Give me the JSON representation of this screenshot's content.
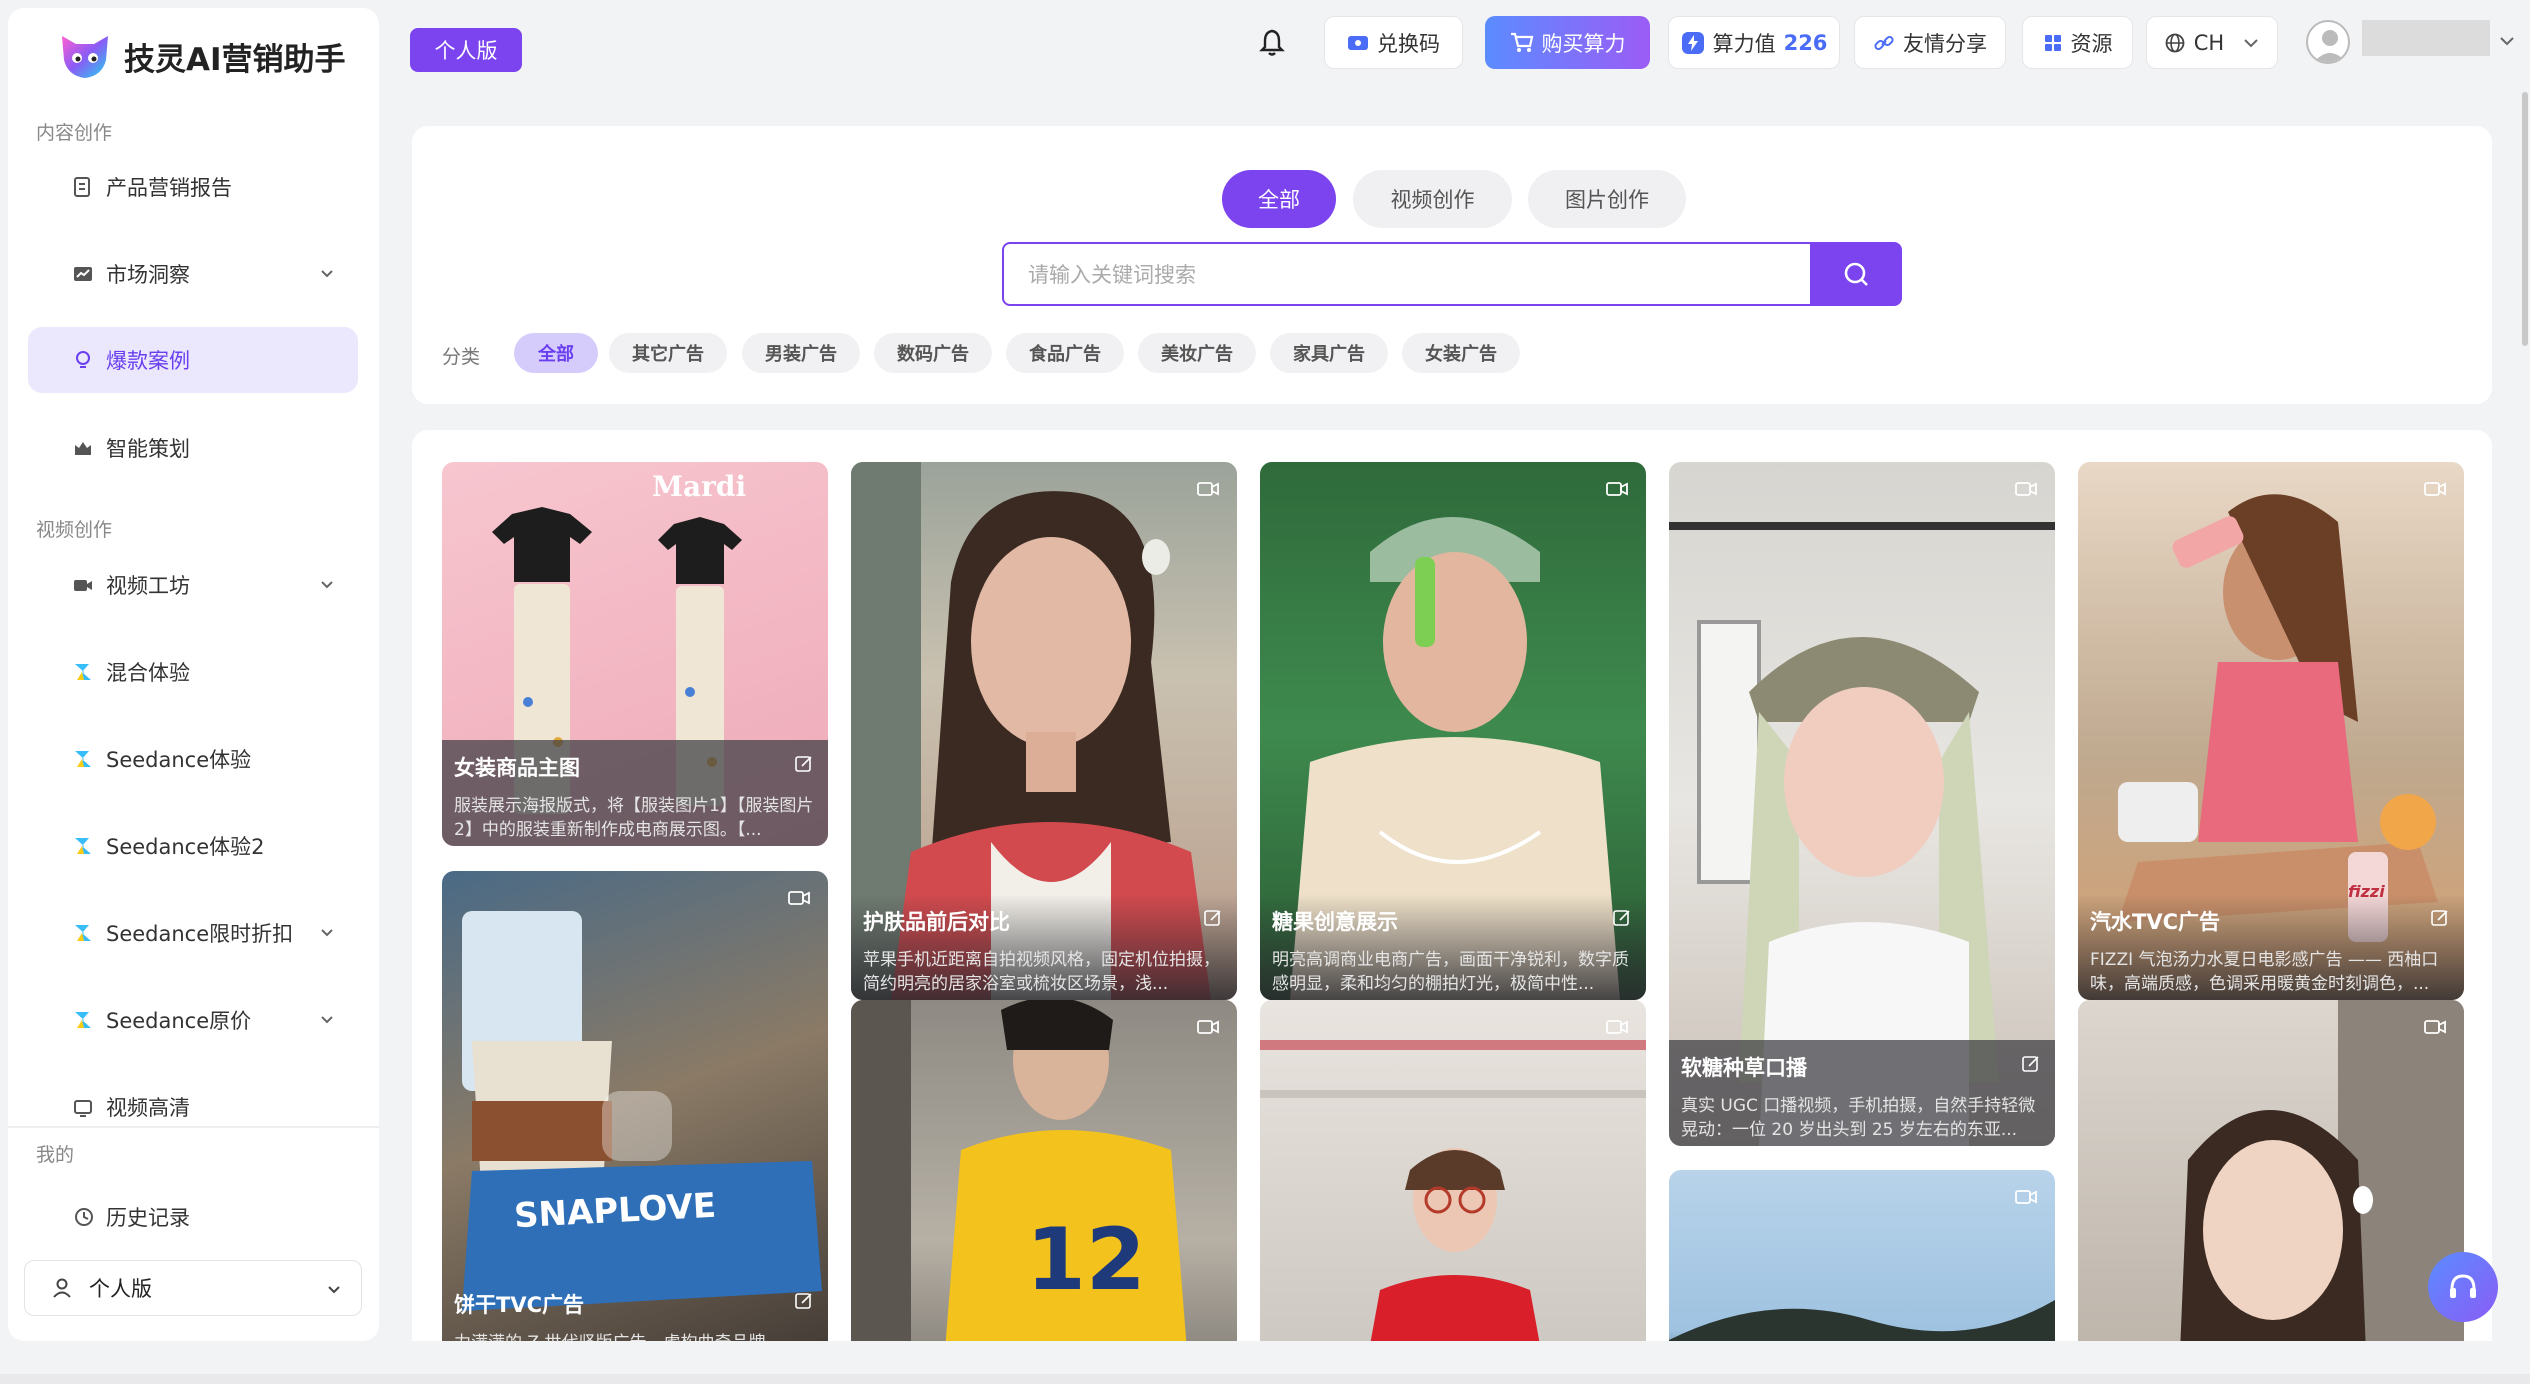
{
  "sidebar": {
    "brand": "技灵AI营销助手",
    "sections": {
      "content": "内容创作",
      "video": "视频创作",
      "mine": "我的"
    },
    "items": [
      {
        "label": "产品营销报告"
      },
      {
        "label": "市场洞察"
      },
      {
        "label": "爆款案例"
      },
      {
        "label": "智能策划"
      },
      {
        "label": "视频工坊"
      },
      {
        "label": "混合体验"
      },
      {
        "label": "Seedance体验"
      },
      {
        "label": "Seedance体验2"
      },
      {
        "label": "Seedance限时折扣"
      },
      {
        "label": "Seedance原价"
      },
      {
        "label": "视频高清"
      },
      {
        "label": "历史记录"
      }
    ],
    "plan_select": "个人版"
  },
  "header": {
    "plan_badge": "个人版",
    "redeem": "兑换码",
    "buy": "购买算力",
    "compute_label": "算力值",
    "compute_value": "226",
    "share": "友情分享",
    "resources": "资源",
    "lang": "CH"
  },
  "search": {
    "tabs": [
      "全部",
      "视频创作",
      "图片创作"
    ],
    "placeholder": "请输入关键词搜索",
    "category_label": "分类",
    "categories": [
      "全部",
      "其它广告",
      "男装广告",
      "数码广告",
      "食品广告",
      "美妆广告",
      "家具广告",
      "女装广告"
    ]
  },
  "cards": [
    {
      "title": "女装商品主图",
      "desc": "服装展示海报版式，将【服装图片1】【服装图片2】中的服装重新制作成电商展示图。【..."
    },
    {
      "title": "护肤品前后对比",
      "desc": "苹果手机近距离自拍视频风格，固定机位拍摄，简约明亮的居家浴室或梳妆区场景，浅..."
    },
    {
      "title": "糖果创意展示",
      "desc": "明亮高调商业电商广告，画面干净锐利，数字质感明显，柔和均匀的棚拍灯光，极简中性..."
    },
    {
      "title": "软糖种草口播",
      "desc": "真实 UGC 口播视频，手机拍摄，自然手持轻微晃动：一位 20 岁出头到 25 岁左右的东亚..."
    },
    {
      "title": "汽水TVC广告",
      "desc": "FIZZI 气泡汤力水夏日电影感广告 —— 西柚口味，高端质感，色调采用暖黄金时刻调色，..."
    },
    {
      "title": "饼干TVC广告",
      "desc": "力满满的 Z 世代竖版广告，虚构曲奇品牌..."
    }
  ],
  "image_text": {
    "mardi": "Mardi",
    "snaplove": "SNAPLOVE",
    "jersey": "12",
    "fizzi": "fizzi"
  },
  "colors": {
    "accent": "#7b44ee",
    "active_bg": "#ebe7fc"
  }
}
